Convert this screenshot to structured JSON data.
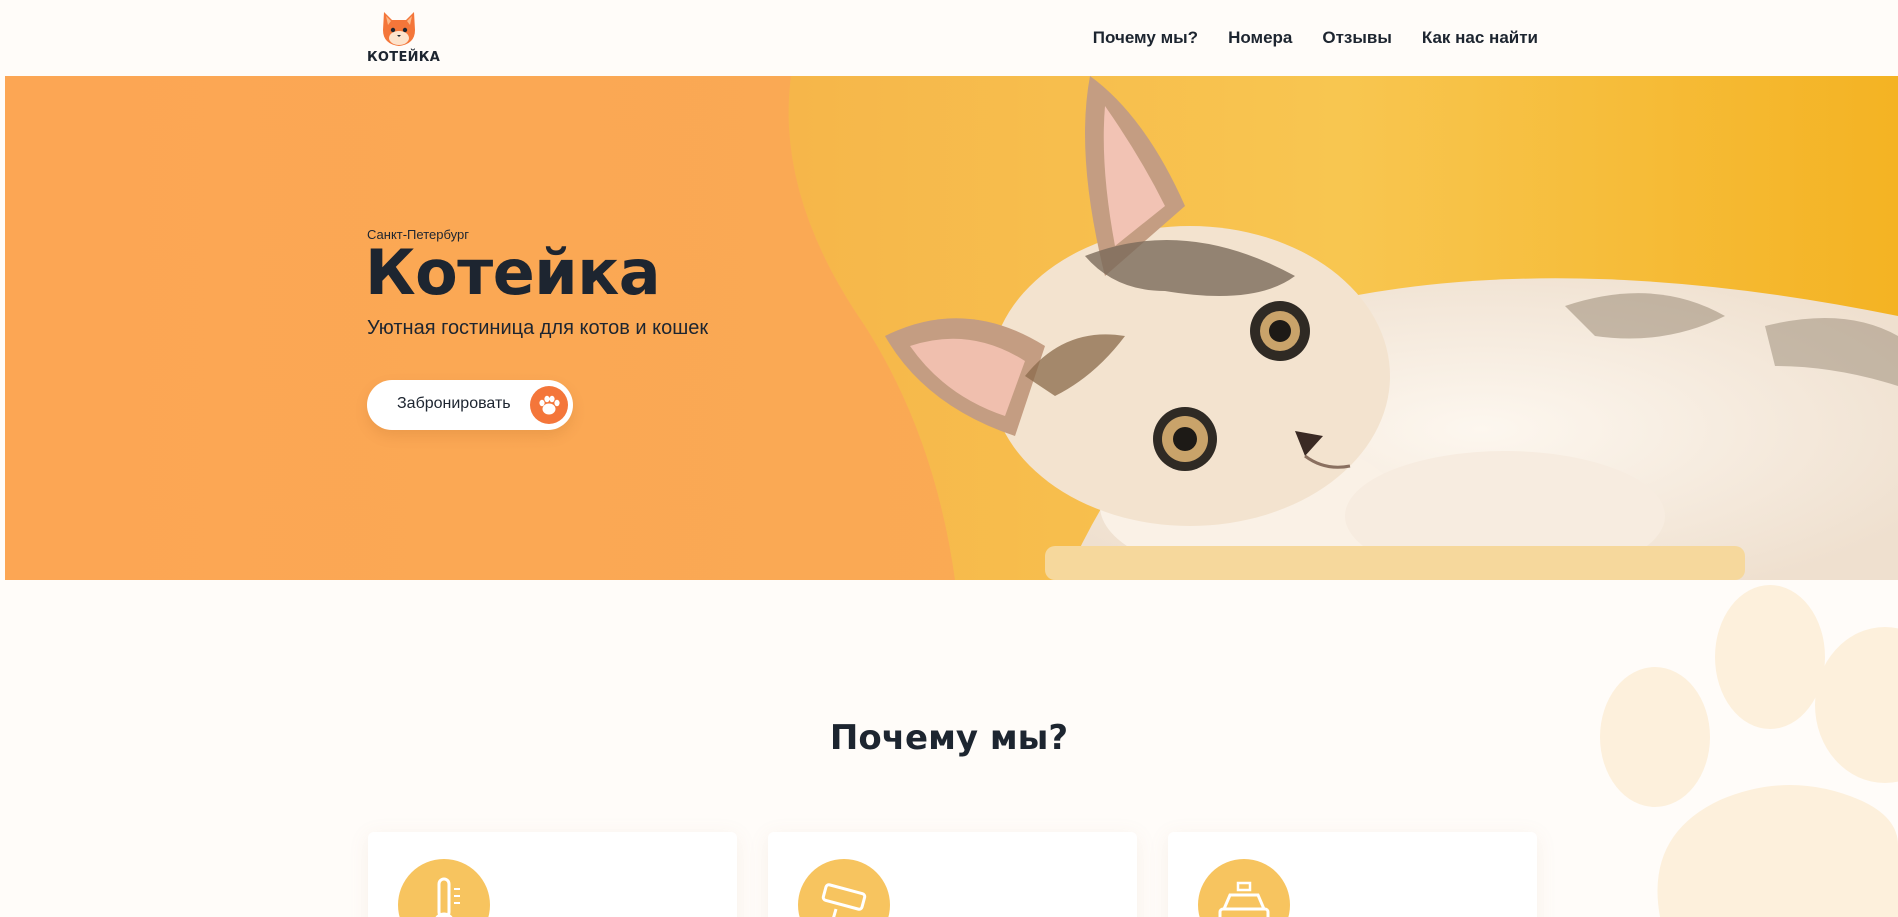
{
  "brand": {
    "logo_text": "КОТЕЙКА",
    "accent": "#f4763a",
    "primary_text": "#1d2530"
  },
  "nav": {
    "items": [
      "Почему мы?",
      "Номера",
      "Отзывы",
      "Как нас найти"
    ]
  },
  "hero": {
    "city": "Санкт-Петербург",
    "title": "Котейка",
    "subtitle": "Уютная гостиница для котов и кошек",
    "cta_label": "Забронировать",
    "cta_icon": "paw-icon",
    "bg_color": "#fca654",
    "photo_bg_color": "#f7bf3c"
  },
  "why": {
    "title": "Почему мы?",
    "cards": [
      {
        "icon": "thermometer-icon"
      },
      {
        "icon": "cctv-camera-icon"
      },
      {
        "icon": "taxi-icon"
      }
    ],
    "icon_circle_color": "#f7c45f"
  }
}
